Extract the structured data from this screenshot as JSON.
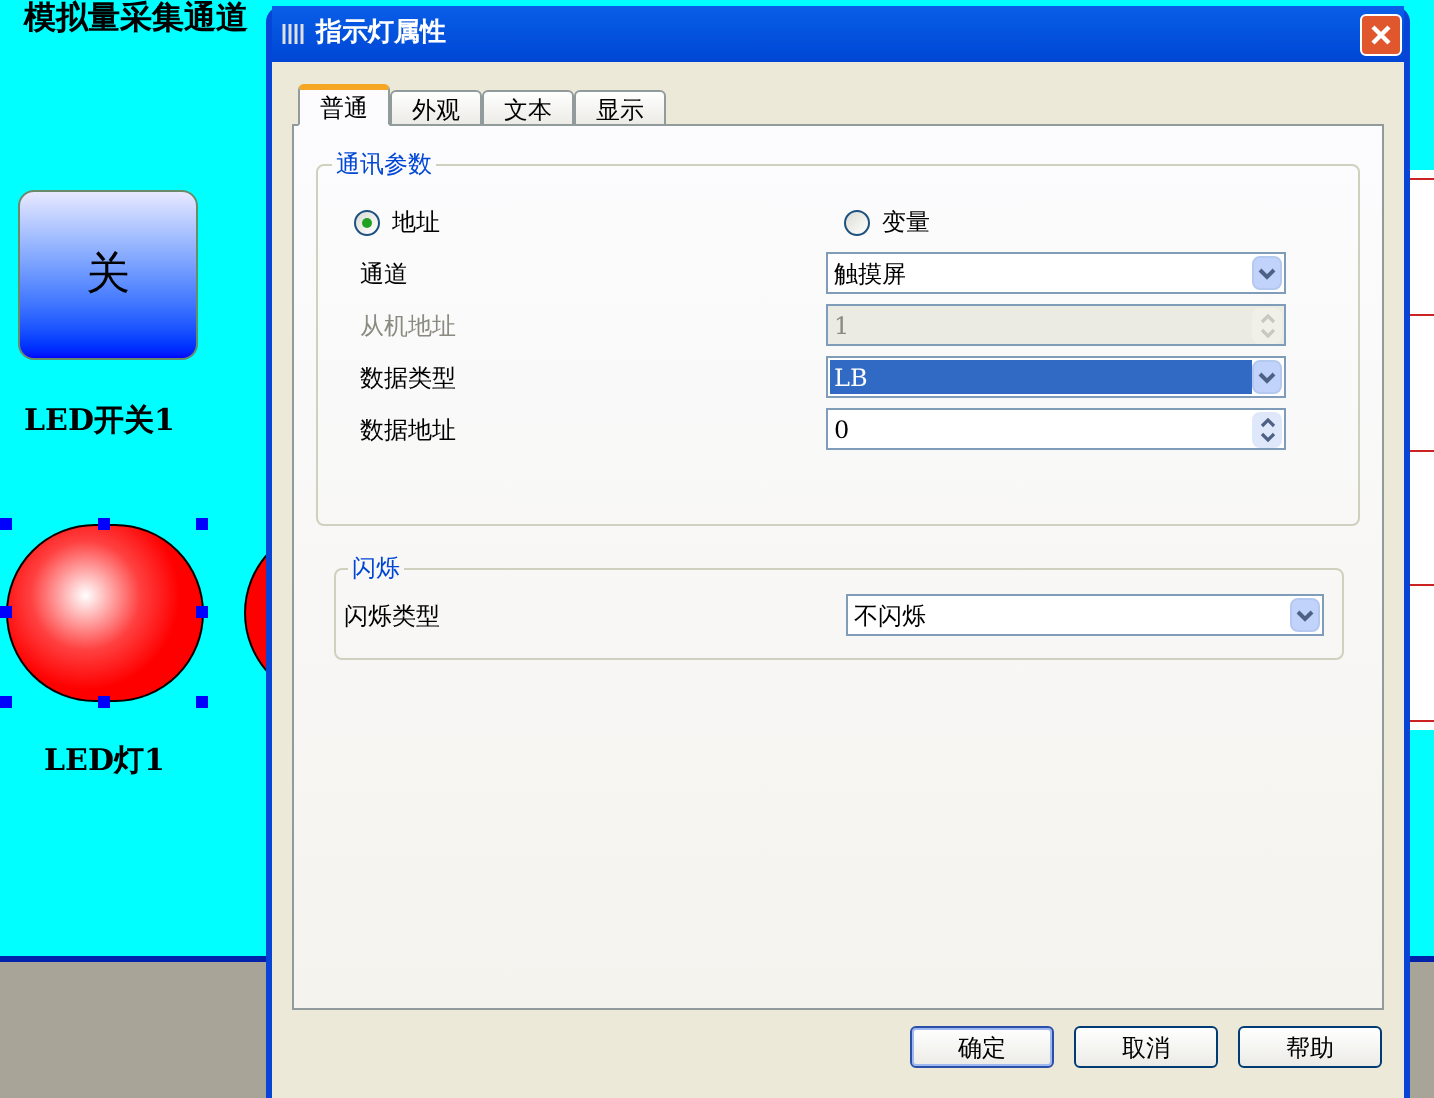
{
  "canvas": {
    "title": "模拟量采集通道",
    "switch_button": {
      "label": "关"
    },
    "switch_caption": "LED开关1",
    "led_caption": "LED灯1",
    "led_selected": true
  },
  "dialog": {
    "title": "指示灯属性",
    "tabs": [
      {
        "label": "普通",
        "selected": true
      },
      {
        "label": "外观",
        "selected": false
      },
      {
        "label": "文本",
        "selected": false
      },
      {
        "label": "显示",
        "selected": false
      }
    ],
    "comm_group": {
      "title": "通讯参数",
      "source_options": [
        {
          "label": "地址",
          "selected": true
        },
        {
          "label": "变量",
          "selected": false
        }
      ],
      "fields": [
        {
          "kind": "select",
          "label": "通道",
          "value": "触摸屏",
          "disabled": false,
          "highlighted": false
        },
        {
          "kind": "spin",
          "label": "从机地址",
          "value": "1",
          "disabled": true,
          "highlighted": false
        },
        {
          "kind": "select",
          "label": "数据类型",
          "value": "LB",
          "disabled": false,
          "highlighted": true
        },
        {
          "kind": "spin",
          "label": "数据地址",
          "value": "0",
          "disabled": false,
          "highlighted": false
        }
      ]
    },
    "blink_group": {
      "title": "闪烁",
      "fields": [
        {
          "kind": "select",
          "label": "闪烁类型",
          "value": "不闪烁",
          "disabled": false,
          "highlighted": false
        }
      ]
    },
    "buttons": [
      {
        "label": "确定",
        "default": true
      },
      {
        "label": "取消",
        "default": false
      },
      {
        "label": "帮助",
        "default": false
      }
    ]
  }
}
